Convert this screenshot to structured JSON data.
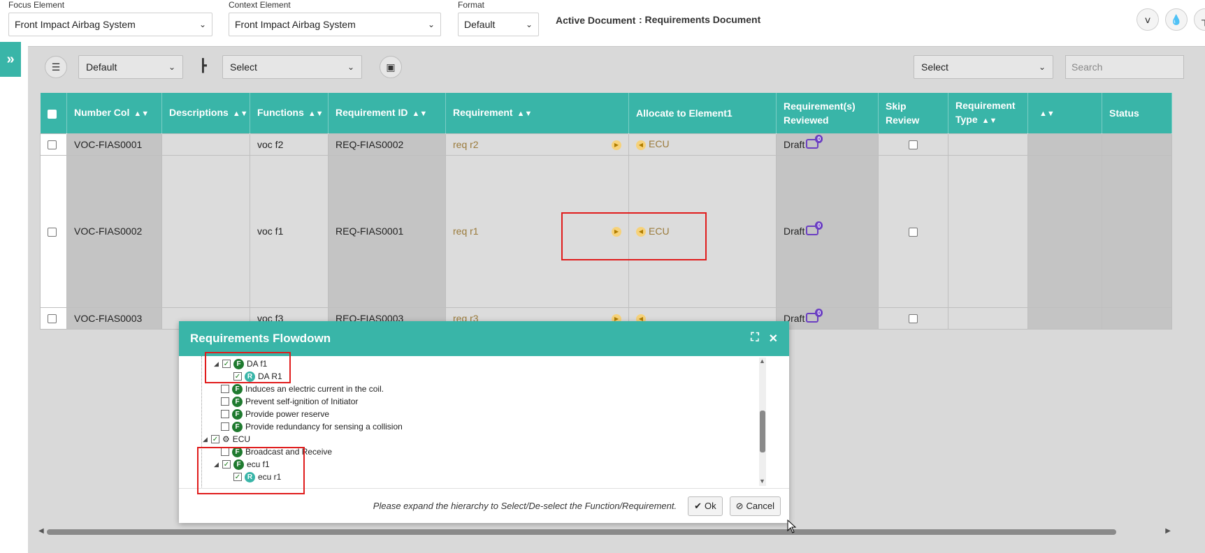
{
  "header": {
    "focus_label": "Focus Element",
    "focus_value": "Front Impact Airbag System",
    "context_label": "Context Element",
    "context_value": "Front Impact Airbag System",
    "format_label": "Format",
    "format_value": "Default",
    "active_doc_label": "Active Document",
    "active_doc_value": ": Requirements Document"
  },
  "toolbar": {
    "view_select": "Default",
    "hierarchy_select": "Select",
    "right_select": "Select",
    "search_placeholder": "Search"
  },
  "table": {
    "columns": [
      {
        "label": "Number Col",
        "sort": true
      },
      {
        "label": "Descriptions",
        "sort": true
      },
      {
        "label": "Functions",
        "sort": true
      },
      {
        "label": "Requirement ID",
        "sort": true
      },
      {
        "label": "Requirement",
        "sort": true
      },
      {
        "label": "Allocate to Element1",
        "sort": false
      },
      {
        "label": "Requirement(s) Reviewed",
        "sort": false
      },
      {
        "label": "Skip Review",
        "sort": false
      },
      {
        "label": "Requirement Type",
        "sort": true
      },
      {
        "label": "",
        "sort": true
      },
      {
        "label": "Status",
        "sort": false
      }
    ],
    "rows": [
      {
        "number": "VOC-FIAS0001",
        "function": "voc f2",
        "req_id": "REQ-FIAS0002",
        "requirement": "req r2",
        "allocate": "ECU",
        "reviewed": "Draft",
        "comments": "0"
      },
      {
        "number": "VOC-FIAS0002",
        "function": "voc f1",
        "req_id": "REQ-FIAS0001",
        "requirement": "req r1",
        "allocate": "ECU",
        "reviewed": "Draft",
        "comments": "0"
      },
      {
        "number": "VOC-FIAS0003",
        "function": "voc f3",
        "req_id": "REQ-FIAS0003",
        "requirement": "req r3",
        "allocate": "",
        "reviewed": "Draft",
        "comments": "0"
      }
    ]
  },
  "dialog": {
    "title": "Requirements Flowdown",
    "tree": {
      "da_f1": "DA f1",
      "da_r1": "DA R1",
      "f_induces": "Induces an electric current in the coil.",
      "f_prevent": "Prevent self-ignition of Initiator",
      "f_power": "Provide power reserve",
      "f_redundancy": "Provide redundancy for sensing a collision",
      "ecu": "ECU",
      "f_broadcast": "Broadcast and Receive",
      "ecu_f1": "ecu f1",
      "ecu_r1": "ecu r1",
      "badge_f": "F",
      "badge_r": "R"
    },
    "note": "Please expand the hierarchy to Select/De-select the Function/Requirement.",
    "ok_label": "Ok",
    "cancel_label": "Cancel"
  },
  "colors": {
    "accent": "#39b5a8",
    "highlight": "#e01c1c"
  }
}
